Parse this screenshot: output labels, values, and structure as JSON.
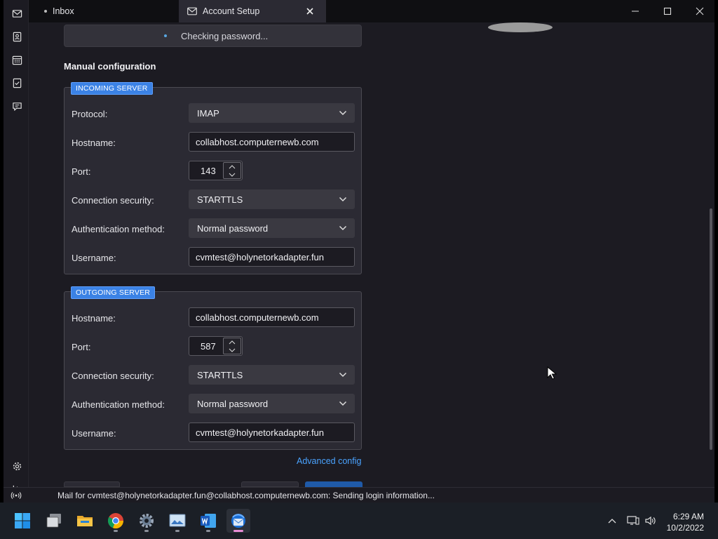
{
  "tabs": {
    "inbox": "Inbox",
    "account_setup": "Account Setup"
  },
  "notice": "Checking password...",
  "section_title": "Manual configuration",
  "incoming": {
    "legend": "INCOMING SERVER",
    "protocol_label": "Protocol:",
    "protocol_value": "IMAP",
    "hostname_label": "Hostname:",
    "hostname_value": "collabhost.computernewb.com",
    "port_label": "Port:",
    "port_value": "143",
    "security_label": "Connection security:",
    "security_value": "STARTTLS",
    "auth_label": "Authentication method:",
    "auth_value": "Normal password",
    "username_label": "Username:",
    "username_value": "cvmtest@holynetorkadapter.fun"
  },
  "outgoing": {
    "legend": "OUTGOING SERVER",
    "hostname_label": "Hostname:",
    "hostname_value": "collabhost.computernewb.com",
    "port_label": "Port:",
    "port_value": "587",
    "security_label": "Connection security:",
    "security_value": "STARTTLS",
    "auth_label": "Authentication method:",
    "auth_value": "Normal password",
    "username_label": "Username:",
    "username_value": "cvmtest@holynetorkadapter.fun"
  },
  "advanced_config": "Advanced config",
  "status_message": "Mail for cvmtest@holynetorkadapter.fun@collabhost.computernewb.com: Sending login information...",
  "clock": {
    "time": "6:29 AM",
    "date": "10/2/2022"
  },
  "colors": {
    "accent": "#3b82e5",
    "link": "#4aa3ff",
    "background": "#1c1b22"
  },
  "icons": {
    "spaces": [
      "mail-icon",
      "address-book-icon",
      "calendar-icon",
      "tasks-icon",
      "chat-icon",
      "settings-icon",
      "collapse-icon"
    ],
    "taskbar": [
      "start-icon",
      "task-view-icon",
      "file-explorer-icon",
      "chrome-icon",
      "settings-icon",
      "photos-icon",
      "word-icon",
      "thunderbird-icon"
    ]
  }
}
